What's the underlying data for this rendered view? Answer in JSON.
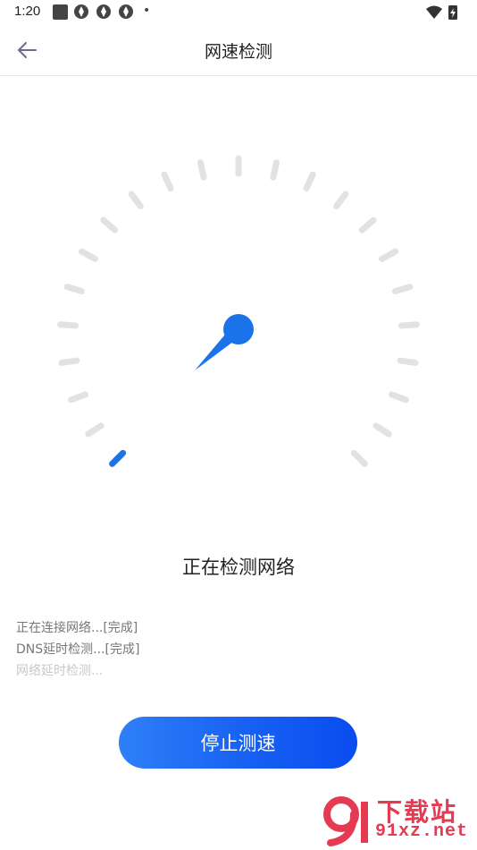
{
  "status_bar": {
    "time": "1:20",
    "icons": [
      "square-notification-icon",
      "app-icon",
      "app-icon",
      "app-icon",
      "dot-icon"
    ],
    "right_icons": [
      "wifi-icon",
      "battery-charging-icon"
    ]
  },
  "header": {
    "back_icon": "arrow-left-icon",
    "title": "网速检测"
  },
  "gauge": {
    "tick_count": 23,
    "needle_color": "#1a73e8",
    "tick_color": "#e2e2e2",
    "progress_ticks": 1
  },
  "status_text": "正在检测网络",
  "log": {
    "lines": [
      "正在连接网络...[完成]",
      "DNS延时检测...[完成]",
      "网络延时检测..."
    ]
  },
  "stop_button": {
    "label": "停止测速"
  },
  "watermark": {
    "title": "下载站",
    "url": "91xz.net",
    "color": "#e43a52"
  }
}
